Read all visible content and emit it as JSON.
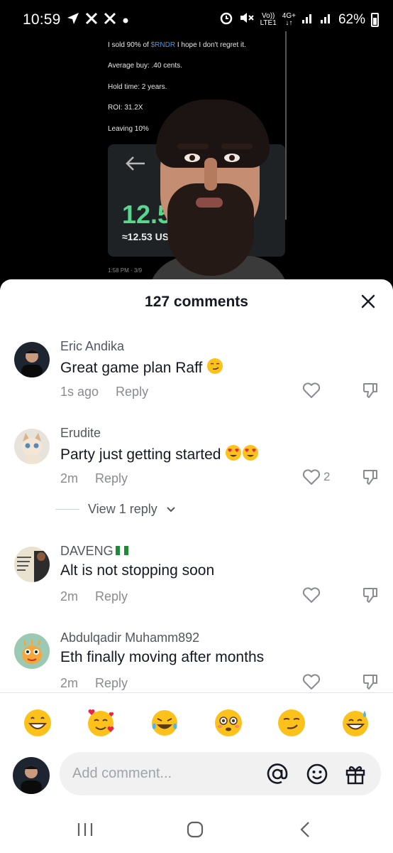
{
  "status_bar": {
    "time": "10:59",
    "left_icons": [
      "navigation-arrow-icon",
      "x-app-icon",
      "x-app-icon",
      "dot-icon"
    ],
    "volte": "Vo))",
    "lte": "LTE1",
    "network": "4G+",
    "battery": "62%",
    "right_icons": [
      "alarm-icon",
      "mute-icon",
      "signal-icon",
      "signal-icon",
      "battery-icon"
    ]
  },
  "video": {
    "tweet_line1_before": "I sold 90% of ",
    "tweet_cashtag": "$RNDR",
    "tweet_line1_after": " I hope I don't regret it.",
    "tweet_line2": "Average buy: .40 cents.",
    "tweet_line3": "Hold time: 2 years.",
    "tweet_line4": "ROI: 31.2X",
    "tweet_line5": "Leaving 10%",
    "card_amount": "12.5",
    "card_usd": "≈12.53 USD",
    "card_time": "1:58 PM · 3/9"
  },
  "sheet": {
    "title": "127 comments"
  },
  "comments": [
    {
      "username": "Eric Andika",
      "text": "Great game plan Raff",
      "emoji": "smirk",
      "time": "1s ago",
      "reply": "Reply",
      "likes": ""
    },
    {
      "username": "Erudite",
      "text": "Party just getting started",
      "emoji": "heart-eyes",
      "time": "2m",
      "reply": "Reply",
      "likes": "2"
    },
    {
      "username": "DAVENG",
      "text": "Alt is not stopping soon",
      "emoji": "",
      "time": "2m",
      "reply": "Reply",
      "likes": ""
    },
    {
      "username": "Abdulqadir Muhamm892",
      "text": "Eth finally moving after months",
      "emoji": "",
      "time": "2m",
      "reply": "Reply",
      "likes": ""
    }
  ],
  "view_replies": "View 1 reply",
  "quick_emojis": [
    "grinning-face",
    "smiling-face-with-hearts",
    "tears-of-joy",
    "flushed-face",
    "smirking-face",
    "sweat-smile"
  ],
  "composer": {
    "placeholder": "Add comment..."
  },
  "colors": {
    "sheet_bg": "#ffffff",
    "text_primary": "#161823",
    "text_secondary": "#8a8b91",
    "input_bg": "#f1f1f2"
  }
}
